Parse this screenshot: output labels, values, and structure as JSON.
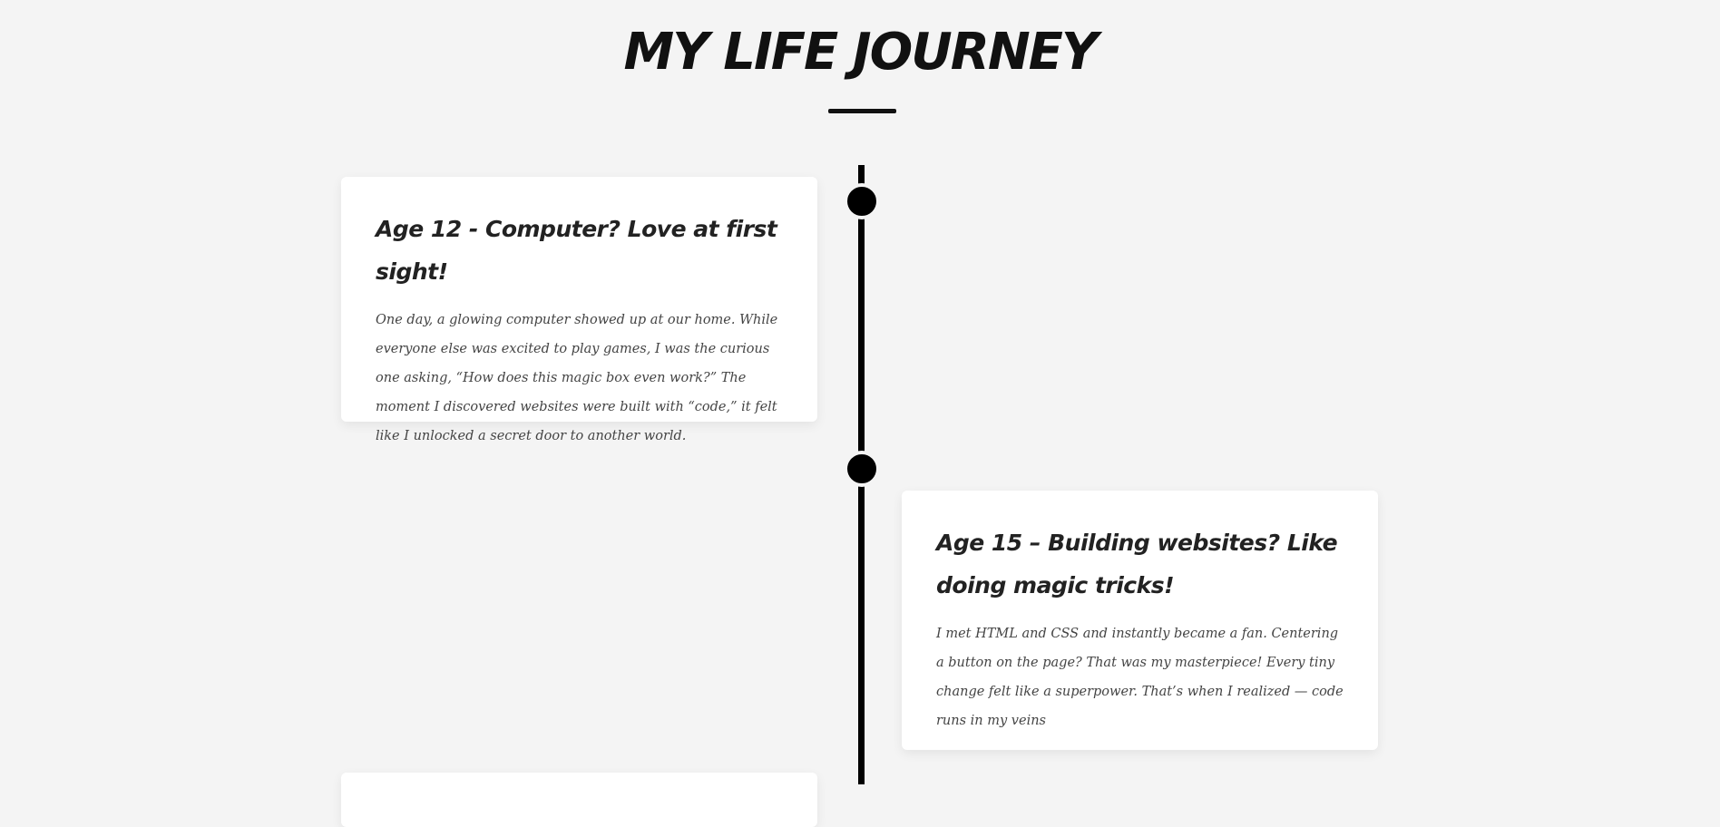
{
  "header": {
    "title": "MY LIFE JOURNEY"
  },
  "timeline": {
    "events": [
      {
        "title": "Age 12 - Computer? Love at first sight!",
        "text": "One day, a glowing computer showed up at our home. While everyone else was excited to play games, I was the curious one asking, “How does this magic box even work?” The moment I discovered websites were built with “code,” it felt like I unlocked a secret door to another world."
      },
      {
        "title": "Age 15 – Building websites? Like doing magic tricks!",
        "text": "I met HTML and CSS and instantly became a fan. Centering a button on the page? That was my masterpiece! Every tiny change felt like a superpower. That’s when I realized — code runs in my veins"
      }
    ]
  },
  "colors": {
    "background": "#f4f4f4",
    "line": "#000000",
    "card": "#ffffff"
  }
}
